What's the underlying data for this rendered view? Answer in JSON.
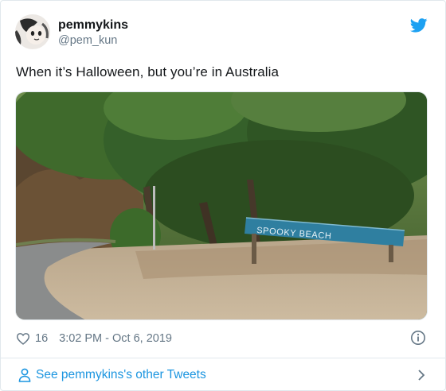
{
  "tweet": {
    "display_name": "pemmykins",
    "handle": "@pem_kun",
    "text": "When it’s Halloween, but you’re in Australia",
    "likes": "16",
    "timestamp": "3:02 PM - Oct 6, 2019"
  },
  "photo": {
    "sign_text": "SPOOKY BEACH"
  },
  "footer": {
    "label": "See pemmykins's other Tweets"
  },
  "icons": {
    "brand": "twitter-bird-icon",
    "like": "heart-icon",
    "info": "info-icon",
    "profile": "person-icon",
    "next": "chevron-right-icon"
  },
  "colors": {
    "accent": "#1da1f2",
    "link": "#1b95e0",
    "muted": "#657786",
    "text": "#14171a"
  }
}
